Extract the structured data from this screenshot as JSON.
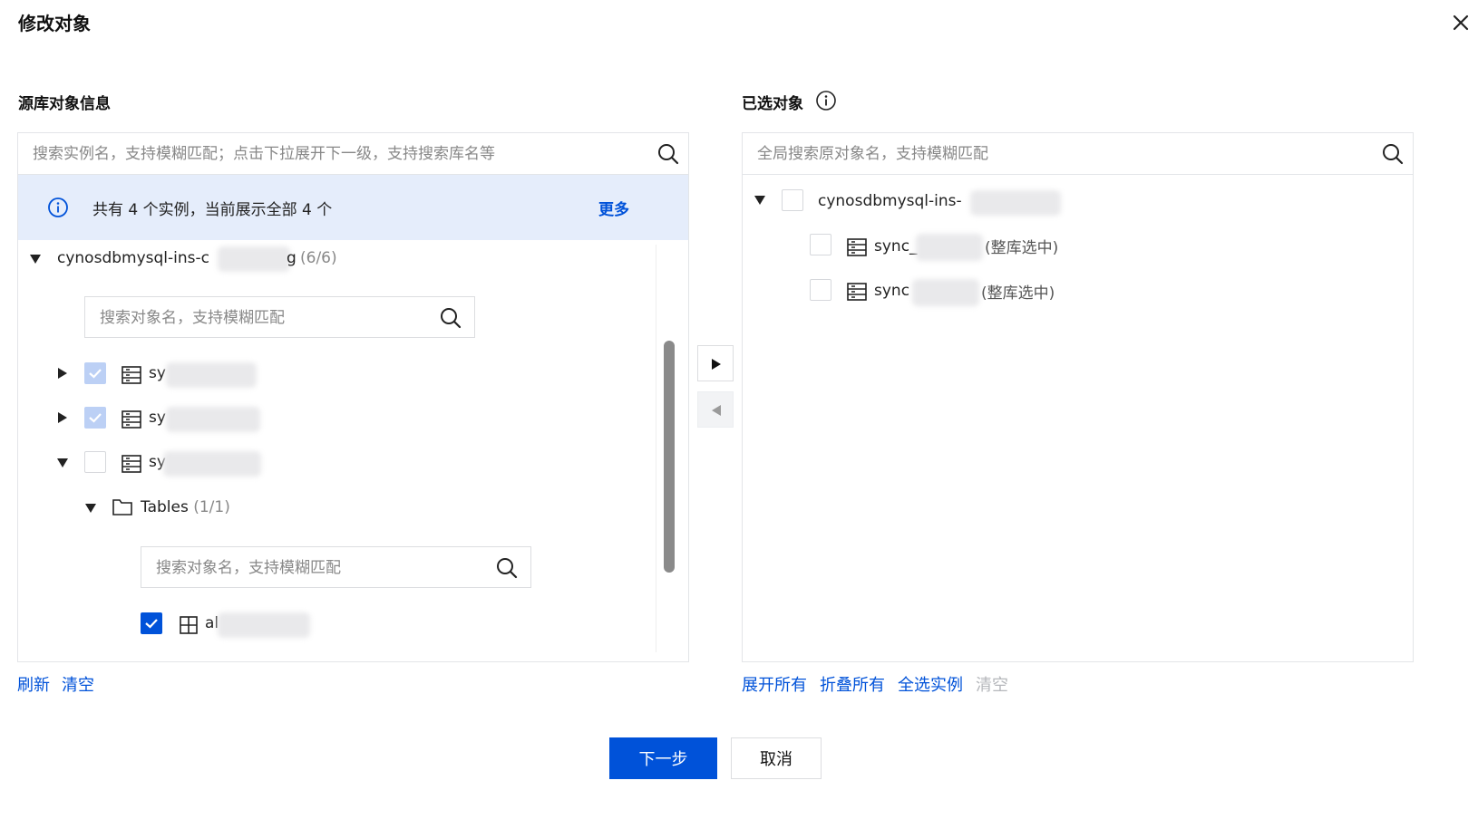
{
  "dialog": {
    "title": "修改对象"
  },
  "source": {
    "title": "源库对象信息",
    "search_placeholder": "搜索实例名，支持模糊匹配；点击下拉展开下一级，支持搜索库名等",
    "banner_text": "共有 4 个实例，当前展示全部 4 个",
    "banner_more": "更多",
    "instance": {
      "name": "cynosdbmysql-ins-c",
      "suffix": "g",
      "count": "(6/6)"
    },
    "db_search_placeholder": "搜索对象名，支持模糊匹配",
    "databases": [
      {
        "label": "sy",
        "checked": "partial"
      },
      {
        "label": "sy",
        "checked": "partial"
      },
      {
        "label": "sy",
        "checked": "none"
      }
    ],
    "tables_folder": {
      "label": "Tables",
      "count": "(1/1)"
    },
    "table_search_placeholder": "搜索对象名，支持模糊匹配",
    "table_item": {
      "label": "al",
      "checked": "true"
    },
    "footer_refresh": "刷新",
    "footer_clear": "清空"
  },
  "selected": {
    "title": "已选对象",
    "search_placeholder": "全局搜索原对象名，支持模糊匹配",
    "instance": {
      "name": "cynosdbmysql-ins-"
    },
    "items": [
      {
        "label": "sync_",
        "note": "(整库选中)"
      },
      {
        "label": "sync",
        "note": "(整库选中)"
      }
    ],
    "footer_expand": "展开所有",
    "footer_collapse": "折叠所有",
    "footer_select_all": "全选实例",
    "footer_clear": "清空"
  },
  "actions": {
    "next": "下一步",
    "cancel": "取消"
  },
  "colors": {
    "primary": "#0052d9",
    "banner_bg": "#e5edfb",
    "border": "#e3e5e8"
  },
  "icons": [
    "close-icon",
    "search-icon",
    "info-icon",
    "caret-right-icon",
    "caret-down-icon",
    "database-icon",
    "folder-icon",
    "table-icon",
    "check-icon",
    "arrow-right-icon",
    "arrow-left-icon"
  ]
}
